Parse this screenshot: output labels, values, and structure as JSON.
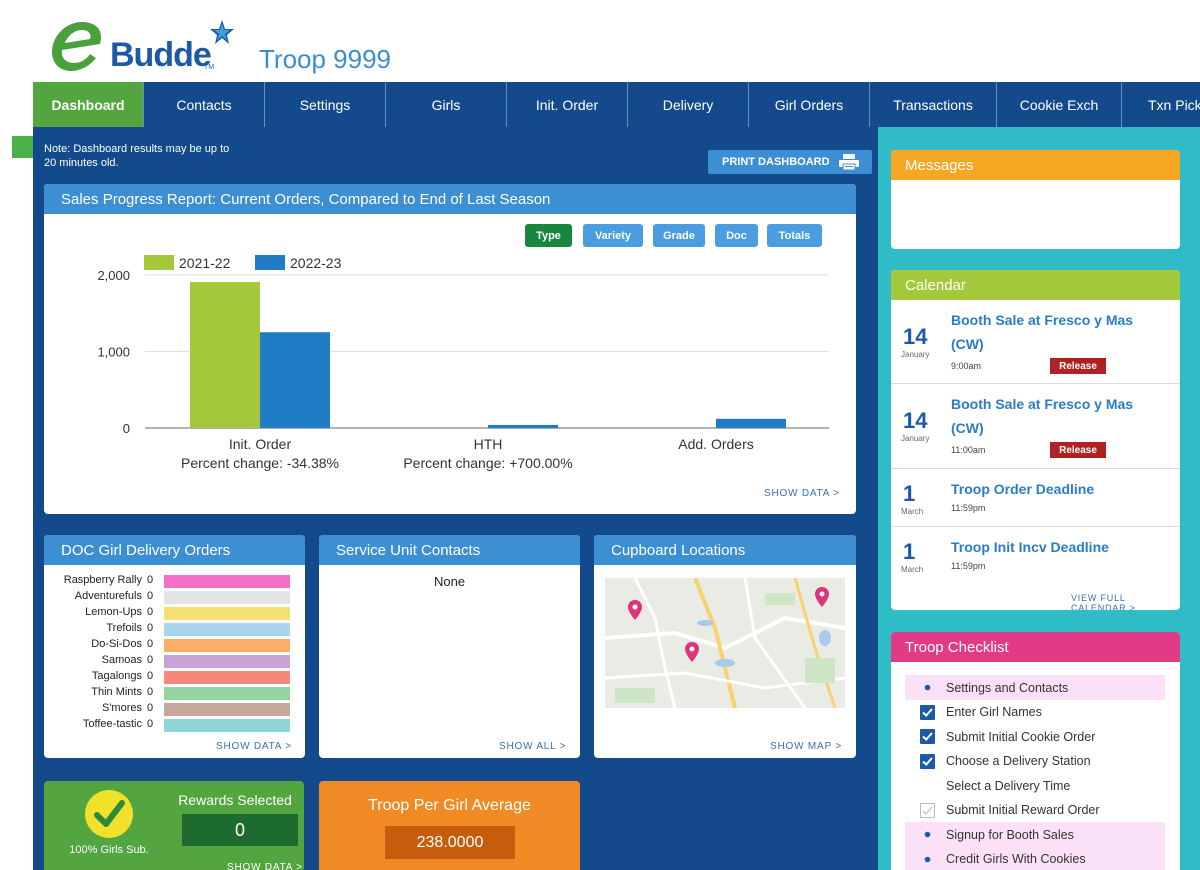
{
  "header": {
    "logo_text": "Budde",
    "logo_tm": "TM",
    "troop_name": "Troop 9999"
  },
  "nav": {
    "tabs": [
      "Dashboard",
      "Contacts",
      "Settings",
      "Girls",
      "Init. Order",
      "Delivery",
      "Girl Orders",
      "Transactions",
      "Cookie Exch",
      "Txn Pickup"
    ],
    "active": "Dashboard"
  },
  "main": {
    "note": "Note: Dashboard results may be up to 20 minutes old.",
    "print_label": "PRINT DASHBOARD"
  },
  "sales": {
    "title": "Sales Progress Report: Current Orders, Compared to End of Last Season",
    "buttons": [
      "Type",
      "Variety",
      "Grade",
      "Doc",
      "Totals"
    ],
    "active_button": "Type",
    "show_data": "SHOW DATA >",
    "percent_changes": [
      "Percent change: -34.38%",
      "Percent change: +700.00%",
      ""
    ]
  },
  "chart_data": {
    "type": "bar",
    "categories": [
      "Init. Order",
      "HTH",
      "Add. Orders"
    ],
    "series": [
      {
        "name": "2021-22",
        "color": "#a3c83b",
        "values": [
          1905,
          0,
          0
        ]
      },
      {
        "name": "2022-23",
        "color": "#1f7dc6",
        "values": [
          1250,
          40,
          120
        ]
      }
    ],
    "yticks": [
      "2,000",
      "1,000",
      "0"
    ],
    "ytick_values": [
      2000,
      1000,
      0
    ],
    "ylim": [
      0,
      2000
    ],
    "grid": true,
    "legend_position": "top-left"
  },
  "doc": {
    "title": "DOC Girl Delivery Orders",
    "items": [
      {
        "label": "Raspberry Rally",
        "value": "0",
        "color": "#f26fc4"
      },
      {
        "label": "Adventurefuls",
        "value": "0",
        "color": "#e3e3e3"
      },
      {
        "label": "Lemon-Ups",
        "value": "0",
        "color": "#f5de72"
      },
      {
        "label": "Trefoils",
        "value": "0",
        "color": "#a9d4ee"
      },
      {
        "label": "Do-Si-Dos",
        "value": "0",
        "color": "#fcae69"
      },
      {
        "label": "Samoas",
        "value": "0",
        "color": "#c9a3d6"
      },
      {
        "label": "Tagalongs",
        "value": "0",
        "color": "#f7877a"
      },
      {
        "label": "Thin Mints",
        "value": "0",
        "color": "#93d5a1"
      },
      {
        "label": "S'mores",
        "value": "0",
        "color": "#c8a69a"
      },
      {
        "label": "Toffee-tastic",
        "value": "0",
        "color": "#8fd6d6"
      }
    ],
    "show_data": "SHOW DATA >"
  },
  "service_unit": {
    "title": "Service Unit Contacts",
    "body": "None",
    "show_all": "SHOW ALL >"
  },
  "cupboard": {
    "title": "Cupboard Locations",
    "show_map": "SHOW MAP >"
  },
  "rewards": {
    "label": "100% Girls Sub.",
    "title": "Rewards Selected",
    "value": "0",
    "show_data": "SHOW DATA >"
  },
  "tpga": {
    "title": "Troop Per Girl Average",
    "value": "238.0000"
  },
  "messages": {
    "title": "Messages"
  },
  "calendar": {
    "title": "Calendar",
    "items": [
      {
        "day": "14",
        "month": "January",
        "title_line1": "Booth Sale at Fresco y Mas",
        "title_line2": "(CW)",
        "time": "9:00am",
        "badge": "Release"
      },
      {
        "day": "14",
        "month": "January",
        "title_line1": "Booth Sale at Fresco y Mas",
        "title_line2": "(CW)",
        "time": "11:00am",
        "badge": "Release"
      },
      {
        "day": "1",
        "month": "March",
        "title_line1": "Troop Order Deadline",
        "title_line2": "",
        "time": "11:59pm",
        "badge": ""
      },
      {
        "day": "1",
        "month": "March",
        "title_line1": "Troop Init Incv Deadline",
        "title_line2": "",
        "time": "11:59pm",
        "badge": ""
      }
    ],
    "view_full": "VIEW FULL CALENDAR >"
  },
  "checklist": {
    "title": "Troop Checklist",
    "items": [
      {
        "label": "Settings and Contacts",
        "state": "bullet",
        "highlight": true
      },
      {
        "label": "Enter Girl Names",
        "state": "checked",
        "highlight": false
      },
      {
        "label": "Submit Initial Cookie Order",
        "state": "checked",
        "highlight": false
      },
      {
        "label": "Choose a Delivery Station",
        "state": "checked",
        "highlight": false
      },
      {
        "label": "Select a Delivery Time",
        "state": "none",
        "highlight": false
      },
      {
        "label": "Submit Initial Reward Order",
        "state": "partial",
        "highlight": false
      },
      {
        "label": "Signup for Booth Sales",
        "state": "bullet",
        "highlight": true
      },
      {
        "label": "Credit Girls With Cookies",
        "state": "bullet",
        "highlight": true
      }
    ]
  },
  "colors": {
    "nav_bg": "#124a8b",
    "active_tab": "#53a63f",
    "card_head": "#3d8fd3",
    "messages_head": "#f5a623",
    "calendar_head": "#a3c83b",
    "checklist_head": "#e23a85",
    "side_bg": "#2fbcc7"
  }
}
